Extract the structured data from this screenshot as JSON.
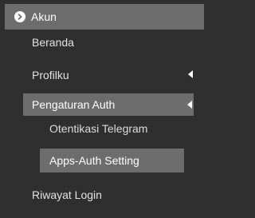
{
  "menu": {
    "header": {
      "label": "Akun",
      "icon": "chevron-circle-icon"
    },
    "items": {
      "beranda": {
        "label": "Beranda"
      },
      "profilku": {
        "label": "Profilku",
        "icon": "caret-left-icon"
      },
      "pengaturan_auth": {
        "label": "Pengaturan Auth",
        "icon": "caret-left-icon",
        "sub_items": {
          "otentikasi": {
            "label": "Otentikasi Telegram"
          },
          "apps_auth": {
            "label": "Apps-Auth Setting"
          }
        }
      },
      "riwayat": {
        "label": "Riwayat Login"
      }
    }
  },
  "colors": {
    "background": "#2f2f2f",
    "active_row": "#6d6d6d",
    "text": "#e6e6e6"
  }
}
